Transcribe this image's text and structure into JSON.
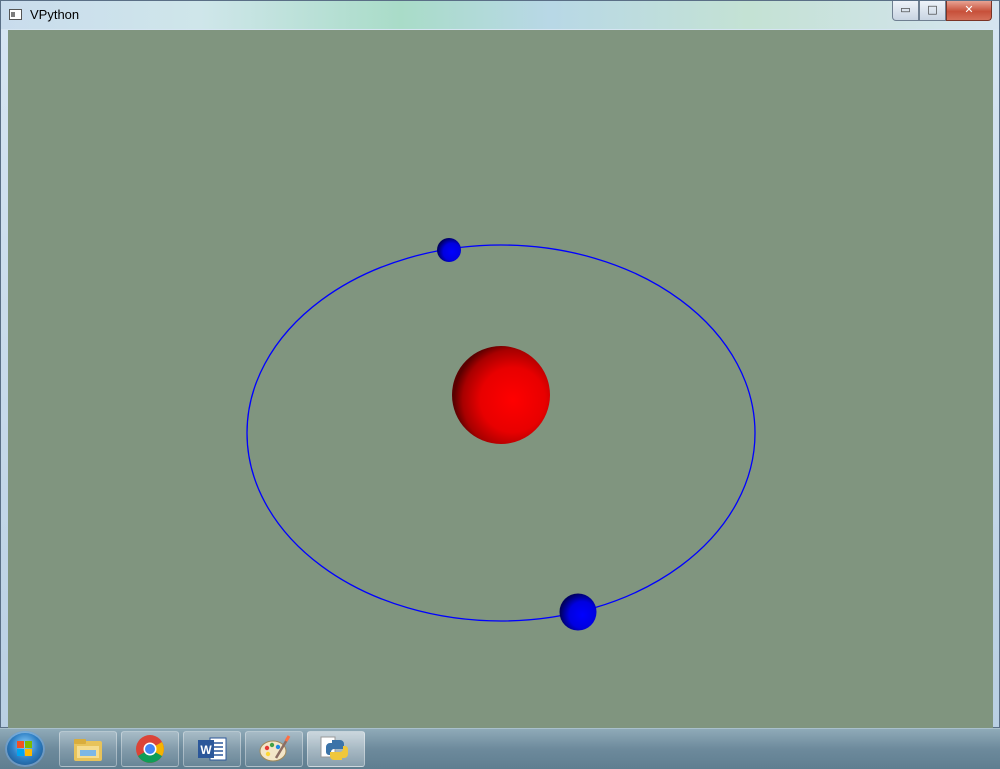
{
  "window": {
    "title": "VPython",
    "controls": {
      "minimize_glyph": "▭",
      "maximize_glyph": "□",
      "close_glyph": "✕"
    }
  },
  "scene": {
    "background_color": "#80957f",
    "objects": [
      {
        "name": "central-red-sphere",
        "color": "#ff0000"
      },
      {
        "name": "orbit-ring",
        "color": "#0000ff"
      },
      {
        "name": "small-blue-sphere",
        "color": "#0000ff"
      },
      {
        "name": "large-blue-sphere",
        "color": "#0000ff"
      }
    ]
  },
  "taskbar": {
    "start_button": "start-orb",
    "pinned": [
      {
        "name": "file-explorer-icon"
      },
      {
        "name": "chrome-icon"
      },
      {
        "name": "word-icon",
        "glyph": "W"
      },
      {
        "name": "paint-icon"
      },
      {
        "name": "python-icon"
      }
    ]
  }
}
